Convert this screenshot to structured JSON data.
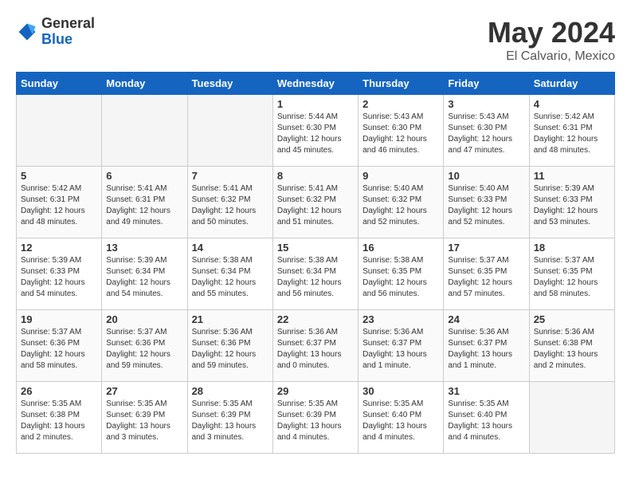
{
  "logo": {
    "general": "General",
    "blue": "Blue"
  },
  "title": "May 2024",
  "location": "El Calvario, Mexico",
  "weekdays": [
    "Sunday",
    "Monday",
    "Tuesday",
    "Wednesday",
    "Thursday",
    "Friday",
    "Saturday"
  ],
  "weeks": [
    [
      {
        "day": "",
        "empty": true
      },
      {
        "day": "",
        "empty": true
      },
      {
        "day": "",
        "empty": true
      },
      {
        "day": "1",
        "sunrise": "5:44 AM",
        "sunset": "6:30 PM",
        "daylight": "12 hours and 45 minutes."
      },
      {
        "day": "2",
        "sunrise": "5:43 AM",
        "sunset": "6:30 PM",
        "daylight": "12 hours and 46 minutes."
      },
      {
        "day": "3",
        "sunrise": "5:43 AM",
        "sunset": "6:30 PM",
        "daylight": "12 hours and 47 minutes."
      },
      {
        "day": "4",
        "sunrise": "5:42 AM",
        "sunset": "6:31 PM",
        "daylight": "12 hours and 48 minutes."
      }
    ],
    [
      {
        "day": "5",
        "sunrise": "5:42 AM",
        "sunset": "6:31 PM",
        "daylight": "12 hours and 48 minutes."
      },
      {
        "day": "6",
        "sunrise": "5:41 AM",
        "sunset": "6:31 PM",
        "daylight": "12 hours and 49 minutes."
      },
      {
        "day": "7",
        "sunrise": "5:41 AM",
        "sunset": "6:32 PM",
        "daylight": "12 hours and 50 minutes."
      },
      {
        "day": "8",
        "sunrise": "5:41 AM",
        "sunset": "6:32 PM",
        "daylight": "12 hours and 51 minutes."
      },
      {
        "day": "9",
        "sunrise": "5:40 AM",
        "sunset": "6:32 PM",
        "daylight": "12 hours and 52 minutes."
      },
      {
        "day": "10",
        "sunrise": "5:40 AM",
        "sunset": "6:33 PM",
        "daylight": "12 hours and 52 minutes."
      },
      {
        "day": "11",
        "sunrise": "5:39 AM",
        "sunset": "6:33 PM",
        "daylight": "12 hours and 53 minutes."
      }
    ],
    [
      {
        "day": "12",
        "sunrise": "5:39 AM",
        "sunset": "6:33 PM",
        "daylight": "12 hours and 54 minutes."
      },
      {
        "day": "13",
        "sunrise": "5:39 AM",
        "sunset": "6:34 PM",
        "daylight": "12 hours and 54 minutes."
      },
      {
        "day": "14",
        "sunrise": "5:38 AM",
        "sunset": "6:34 PM",
        "daylight": "12 hours and 55 minutes."
      },
      {
        "day": "15",
        "sunrise": "5:38 AM",
        "sunset": "6:34 PM",
        "daylight": "12 hours and 56 minutes."
      },
      {
        "day": "16",
        "sunrise": "5:38 AM",
        "sunset": "6:35 PM",
        "daylight": "12 hours and 56 minutes."
      },
      {
        "day": "17",
        "sunrise": "5:37 AM",
        "sunset": "6:35 PM",
        "daylight": "12 hours and 57 minutes."
      },
      {
        "day": "18",
        "sunrise": "5:37 AM",
        "sunset": "6:35 PM",
        "daylight": "12 hours and 58 minutes."
      }
    ],
    [
      {
        "day": "19",
        "sunrise": "5:37 AM",
        "sunset": "6:36 PM",
        "daylight": "12 hours and 58 minutes."
      },
      {
        "day": "20",
        "sunrise": "5:37 AM",
        "sunset": "6:36 PM",
        "daylight": "12 hours and 59 minutes."
      },
      {
        "day": "21",
        "sunrise": "5:36 AM",
        "sunset": "6:36 PM",
        "daylight": "12 hours and 59 minutes."
      },
      {
        "day": "22",
        "sunrise": "5:36 AM",
        "sunset": "6:37 PM",
        "daylight": "13 hours and 0 minutes."
      },
      {
        "day": "23",
        "sunrise": "5:36 AM",
        "sunset": "6:37 PM",
        "daylight": "13 hours and 1 minute."
      },
      {
        "day": "24",
        "sunrise": "5:36 AM",
        "sunset": "6:37 PM",
        "daylight": "13 hours and 1 minute."
      },
      {
        "day": "25",
        "sunrise": "5:36 AM",
        "sunset": "6:38 PM",
        "daylight": "13 hours and 2 minutes."
      }
    ],
    [
      {
        "day": "26",
        "sunrise": "5:35 AM",
        "sunset": "6:38 PM",
        "daylight": "13 hours and 2 minutes."
      },
      {
        "day": "27",
        "sunrise": "5:35 AM",
        "sunset": "6:39 PM",
        "daylight": "13 hours and 3 minutes."
      },
      {
        "day": "28",
        "sunrise": "5:35 AM",
        "sunset": "6:39 PM",
        "daylight": "13 hours and 3 minutes."
      },
      {
        "day": "29",
        "sunrise": "5:35 AM",
        "sunset": "6:39 PM",
        "daylight": "13 hours and 4 minutes."
      },
      {
        "day": "30",
        "sunrise": "5:35 AM",
        "sunset": "6:40 PM",
        "daylight": "13 hours and 4 minutes."
      },
      {
        "day": "31",
        "sunrise": "5:35 AM",
        "sunset": "6:40 PM",
        "daylight": "13 hours and 4 minutes."
      },
      {
        "day": "",
        "empty": true
      }
    ]
  ]
}
